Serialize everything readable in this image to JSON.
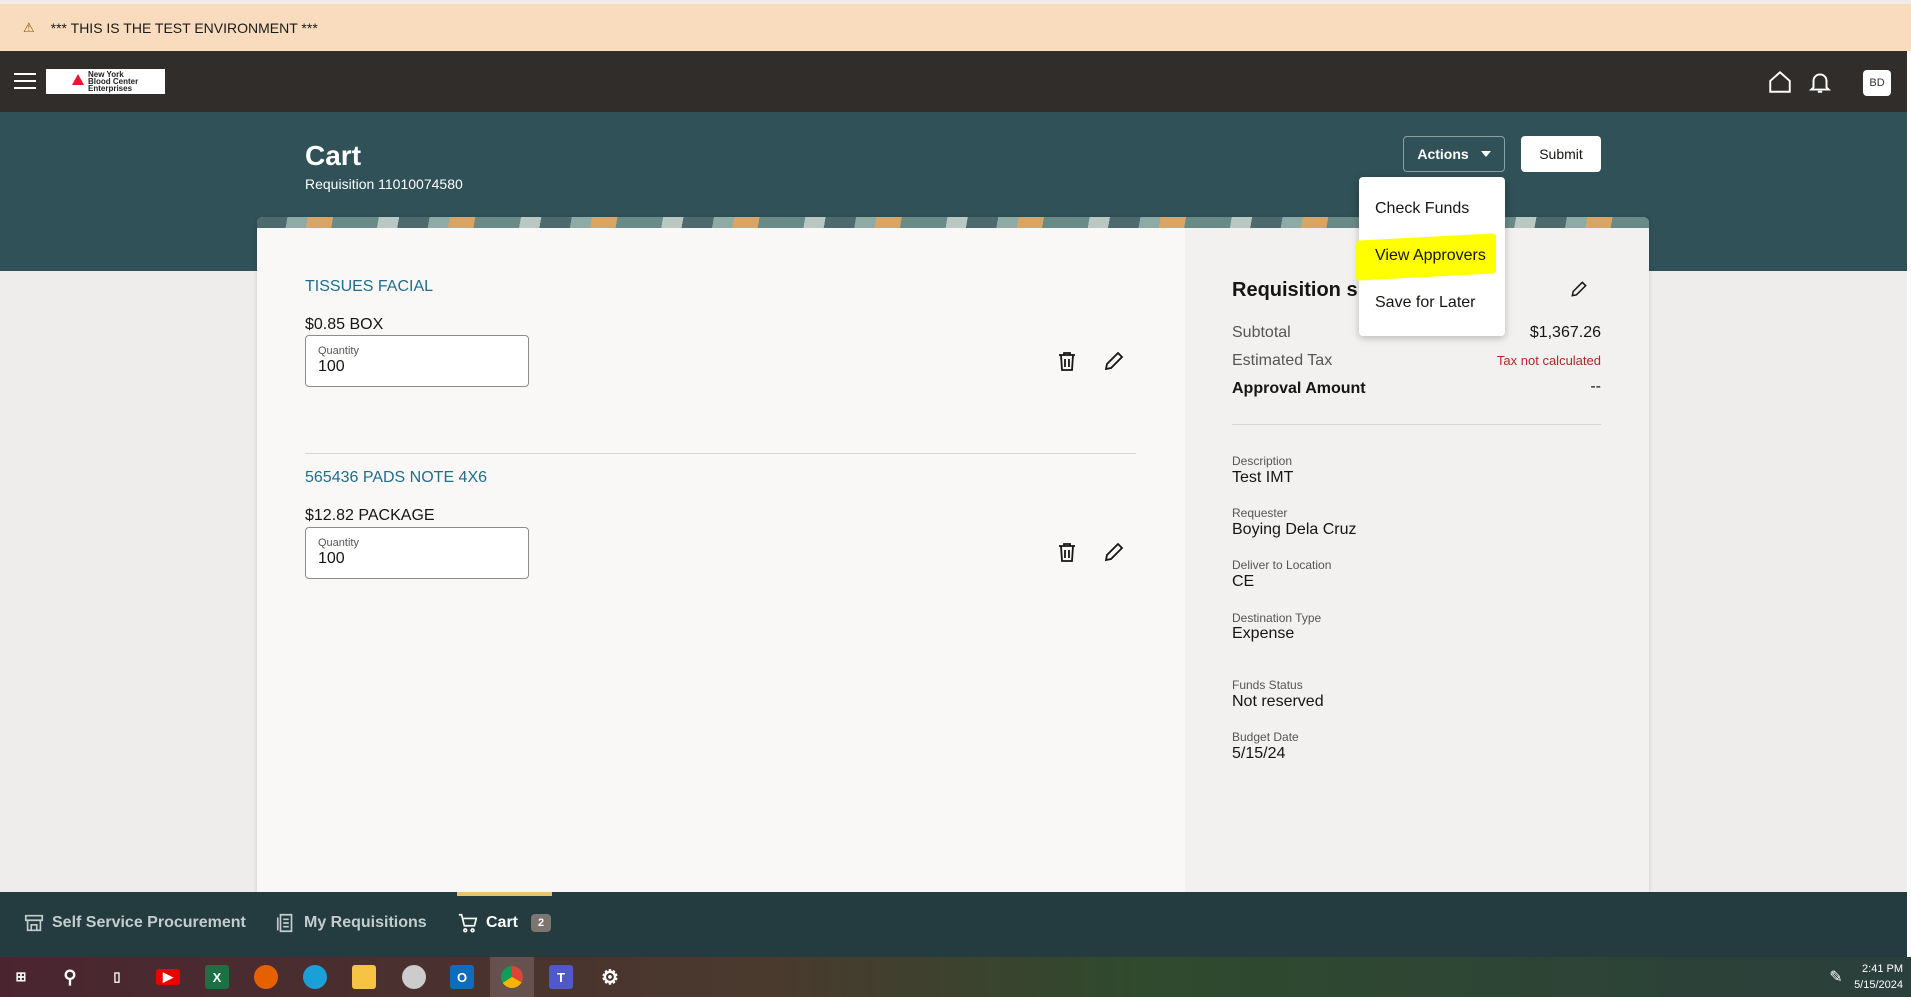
{
  "banner": {
    "text": "*** THIS IS THE TEST ENVIRONMENT ***",
    "icon": "warning-icon"
  },
  "header": {
    "logo_text": [
      "New York",
      "Blood Center",
      "Enterprises"
    ],
    "avatar": "BD"
  },
  "page": {
    "title": "Cart",
    "requisition": "Requisition 11010074580"
  },
  "toolbar": {
    "actions_label": "Actions",
    "submit_label": "Submit"
  },
  "actions_menu": {
    "items": [
      {
        "label": "Check Funds"
      },
      {
        "label": "View Approvers",
        "highlighted": true
      },
      {
        "label": "Save for Later"
      }
    ]
  },
  "items": [
    {
      "name": "TISSUES FACIAL",
      "price": "$0.85 BOX",
      "quantity_label": "Quantity",
      "quantity": "100"
    },
    {
      "name": "565436 PADS NOTE 4X6",
      "price": "$12.82 PACKAGE",
      "quantity_label": "Quantity",
      "quantity": "100"
    }
  ],
  "summary": {
    "title": "Requisition s",
    "subtotal_label": "Subtotal",
    "subtotal": "$1,367.26",
    "tax_label": "Estimated Tax",
    "tax": "Tax not calculated",
    "approval_label": "Approval Amount",
    "approval": "--",
    "fields": [
      {
        "label": "Description",
        "value": "Test IMT"
      },
      {
        "label": "Requester",
        "value": "Boying Dela Cruz"
      },
      {
        "label": "Deliver to Location",
        "value": "CE"
      },
      {
        "label": "Destination Type",
        "value": "Expense"
      },
      {
        "label": "Funds Status",
        "value": "Not reserved"
      },
      {
        "label": "Budget Date",
        "value": "5/15/24"
      }
    ]
  },
  "bottom_nav": [
    {
      "label": "Self Service Procurement"
    },
    {
      "label": "My Requisitions"
    },
    {
      "label": "Cart",
      "badge": "2"
    }
  ],
  "taskbar": {
    "time": "2:41 PM",
    "date": "5/15/2024"
  },
  "colors": {
    "hero": "#2f5157",
    "header": "#312d2a",
    "link": "#1e6e8c",
    "tax": "#b3262d",
    "highlight": "#ffff00"
  }
}
